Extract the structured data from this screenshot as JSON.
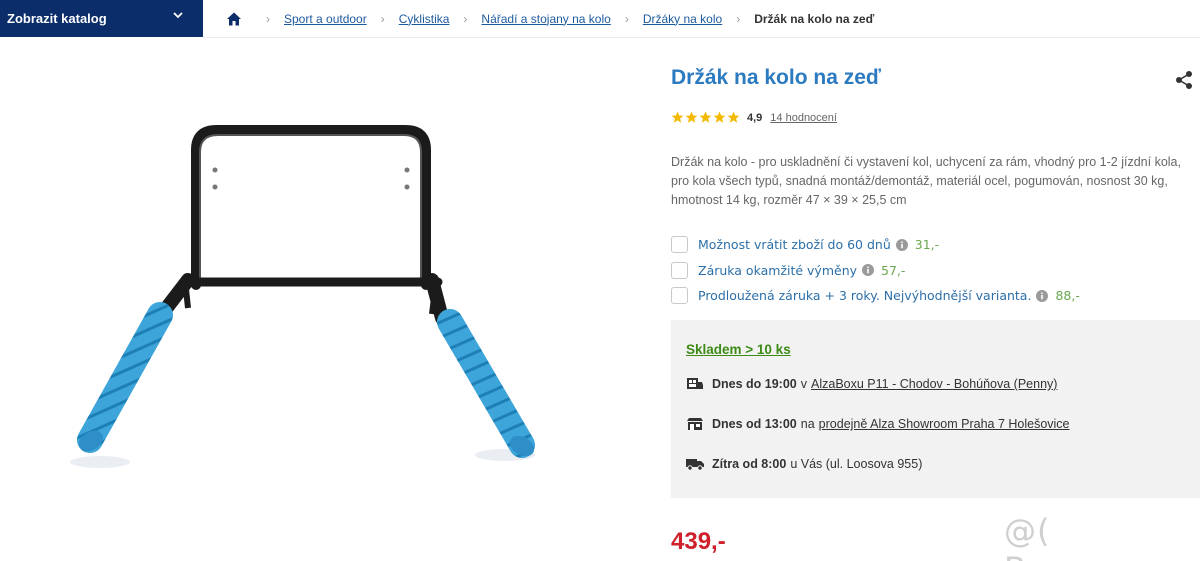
{
  "catalog": {
    "label": "Zobrazit katalog",
    "icon": "chevron-down-icon"
  },
  "breadcrumb": {
    "items": [
      "Sport a outdoor",
      "Cyklistika",
      "Nářadí a stojany na kolo",
      "Držáky na kolo"
    ],
    "current": "Držák na kolo na zeď"
  },
  "product": {
    "title": "Držák na kolo na zeď",
    "rating": {
      "stars": 5,
      "value": "4,9",
      "reviews": "14 hodnocení"
    },
    "description": "Držák na kolo - pro uskladnění či vystavení kol, uchycení za rám, vhodný pro 1-2 jízdní kola, pro kola všech typů, snadná montáž/demontáž, materiál ocel, pogumován, nosnost 30 kg, hmotnost 14 kg, rozměr 47 × 39 × 25,5 cm",
    "options": [
      {
        "label": "Možnost vrátit zboží do 60 dnů",
        "price": "31,-"
      },
      {
        "label": "Záruka okamžité výměny",
        "price": "57,-"
      },
      {
        "label": "Prodloužená záruka + 3 roky. Nejvýhodnější varianta.",
        "price": "88,-"
      }
    ],
    "stock": {
      "title": "Skladem > 10 ks",
      "delivery": [
        {
          "bold": "Dnes do 19:00",
          "prep": "v",
          "link": "AlzaBoxu P11 - Chodov - Bohúňova (Penny)"
        },
        {
          "bold": "Dnes od 13:00",
          "prep": "na",
          "link": "prodejně Alza Showroom Praha 7 Holešovice"
        },
        {
          "bold": "Zítra od 8:00",
          "prep": "u Vás (ul. Loosova 955)",
          "link": ""
        }
      ]
    },
    "price": "439,-"
  },
  "watermark": "@( Bazos.cz",
  "colors": {
    "navy": "#0b2e6b",
    "link": "#2c7bc0",
    "stock": "#3d8b16",
    "price": "#d0202c",
    "star": "#f5b800"
  }
}
